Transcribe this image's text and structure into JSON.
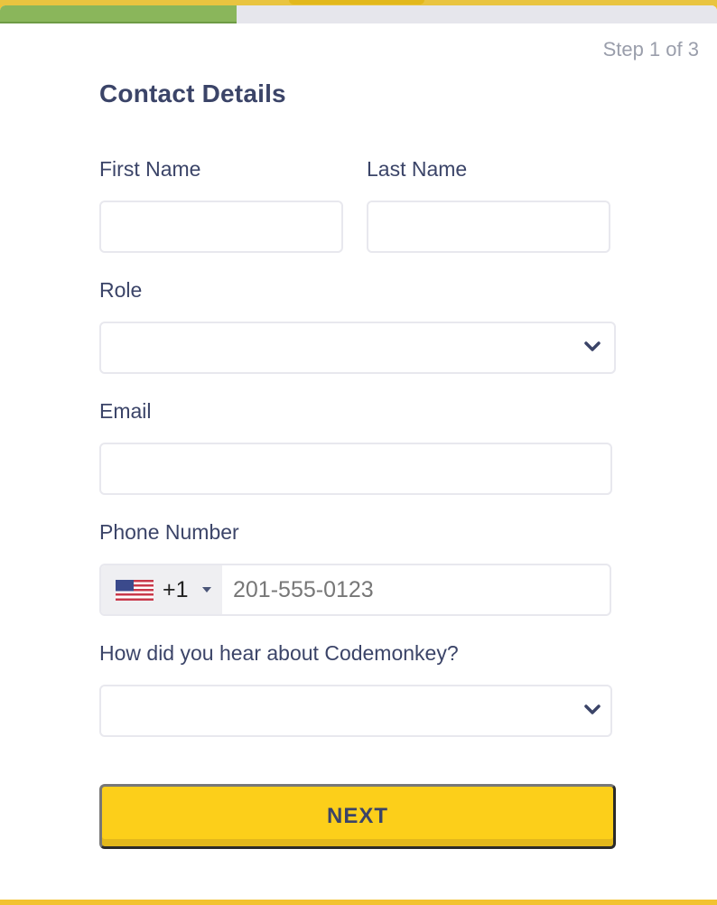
{
  "progress": {
    "current_step": 1,
    "total_steps": 3,
    "fraction": 0.33,
    "fill_color": "#8ab65b",
    "track_color": "#e6e6ec"
  },
  "step_text": "Step 1 of 3",
  "title": "Contact Details",
  "fields": {
    "first_name": {
      "label": "First Name",
      "value": ""
    },
    "last_name": {
      "label": "Last Name",
      "value": ""
    },
    "role": {
      "label": "Role",
      "selected": ""
    },
    "email": {
      "label": "Email",
      "value": ""
    },
    "phone": {
      "label": "Phone Number",
      "country_code": "+1",
      "country_flag": "us-flag",
      "placeholder": "201-555-0123",
      "value": ""
    },
    "referral": {
      "label": "How did you hear about Codemonkey?",
      "selected": ""
    }
  },
  "next_button": {
    "label": "NEXT",
    "color": "#fccf1a"
  },
  "colors": {
    "accent": "#fccf1a",
    "text": "#3b4468",
    "background": "#f2c230"
  }
}
